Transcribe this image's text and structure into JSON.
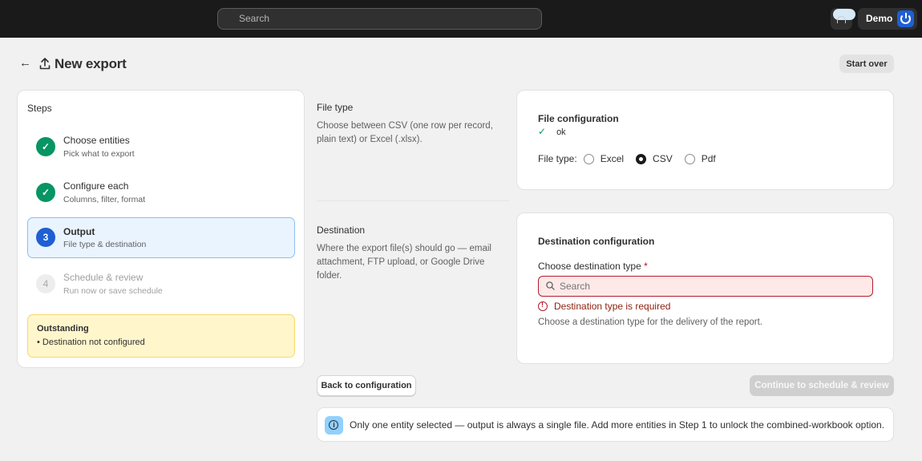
{
  "topbar": {
    "search_placeholder": "Search",
    "user_name": "Demo"
  },
  "header": {
    "title": "New export",
    "start_over_label": "Start over"
  },
  "steps": {
    "title": "Steps",
    "items": [
      {
        "number": "✓",
        "label": "Choose entities",
        "sub": "Pick what to export",
        "state": "done"
      },
      {
        "number": "✓",
        "label": "Configure each",
        "sub": "Columns, filter, format",
        "state": "done"
      },
      {
        "number": "3",
        "label": "Output",
        "sub": "File type & destination",
        "state": "current"
      },
      {
        "number": "4",
        "label": "Schedule & review",
        "sub": "Run now or save schedule",
        "state": "pending"
      }
    ],
    "outstanding": {
      "title": "Outstanding",
      "item": "• Destination not configured"
    }
  },
  "file_type_section": {
    "title": "File type",
    "description": "Choose between CSV (one row per record, plain text) or Excel (.xlsx)."
  },
  "destination_section": {
    "title": "Destination",
    "description": "Where the export file(s) should go — email attachment, FTP upload, or Google Drive folder."
  },
  "file_config": {
    "title": "File configuration",
    "status": "ok",
    "file_type_label": "File type:",
    "options": [
      "Excel",
      "CSV",
      "Pdf"
    ],
    "selected": "CSV"
  },
  "destination_config": {
    "title": "Destination configuration",
    "field_label": "Choose destination type",
    "required_marker": "*",
    "input_placeholder": "Search",
    "error": "Destination type is required",
    "help": "Choose a destination type for the delivery of the report."
  },
  "actions": {
    "back_label": "Back to configuration",
    "continue_label": "Continue to schedule & review"
  },
  "info_banner": {
    "text": "Only one entity selected — output is always a single file. Add more entities in Step 1 to unlock the combined-workbook option."
  },
  "colors": {
    "accent": "#1f5fd4",
    "success": "#079563",
    "critical": "#b41c2f",
    "warning_bg": "#fff6cc",
    "info_icon_bg": "#91d0ff"
  }
}
